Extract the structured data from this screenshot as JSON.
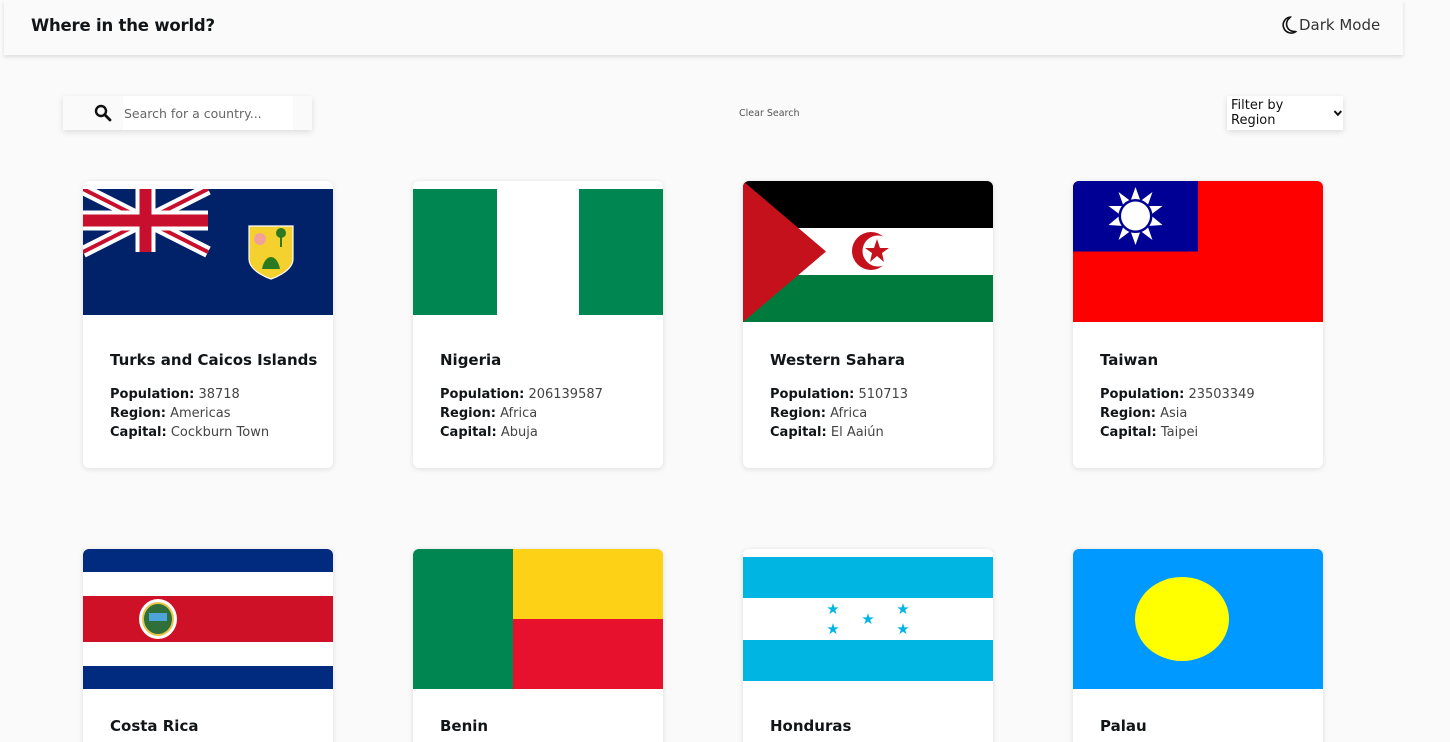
{
  "header": {
    "title": "Where in the world?",
    "mode_label": "Dark Mode"
  },
  "toolbar": {
    "search_placeholder": "Search for a country...",
    "search_value": "",
    "clear_label": "Clear Search",
    "filter_label": "Filter by Region"
  },
  "labels": {
    "population": "Population:",
    "region": "Region:",
    "capital": "Capital:"
  },
  "countries": [
    {
      "name": "Turks and Caicos Islands",
      "population": "38718",
      "region": "Americas",
      "capital": "Cockburn Town"
    },
    {
      "name": "Nigeria",
      "population": "206139587",
      "region": "Africa",
      "capital": "Abuja"
    },
    {
      "name": "Western Sahara",
      "population": "510713",
      "region": "Africa",
      "capital": "El Aaiún"
    },
    {
      "name": "Taiwan",
      "population": "23503349",
      "region": "Asia",
      "capital": "Taipei"
    },
    {
      "name": "Costa Rica"
    },
    {
      "name": "Benin"
    },
    {
      "name": "Honduras"
    },
    {
      "name": "Palau"
    }
  ],
  "icons": {
    "mode": "moon-icon",
    "search": "search-icon",
    "filter": "chevron-down-icon"
  }
}
